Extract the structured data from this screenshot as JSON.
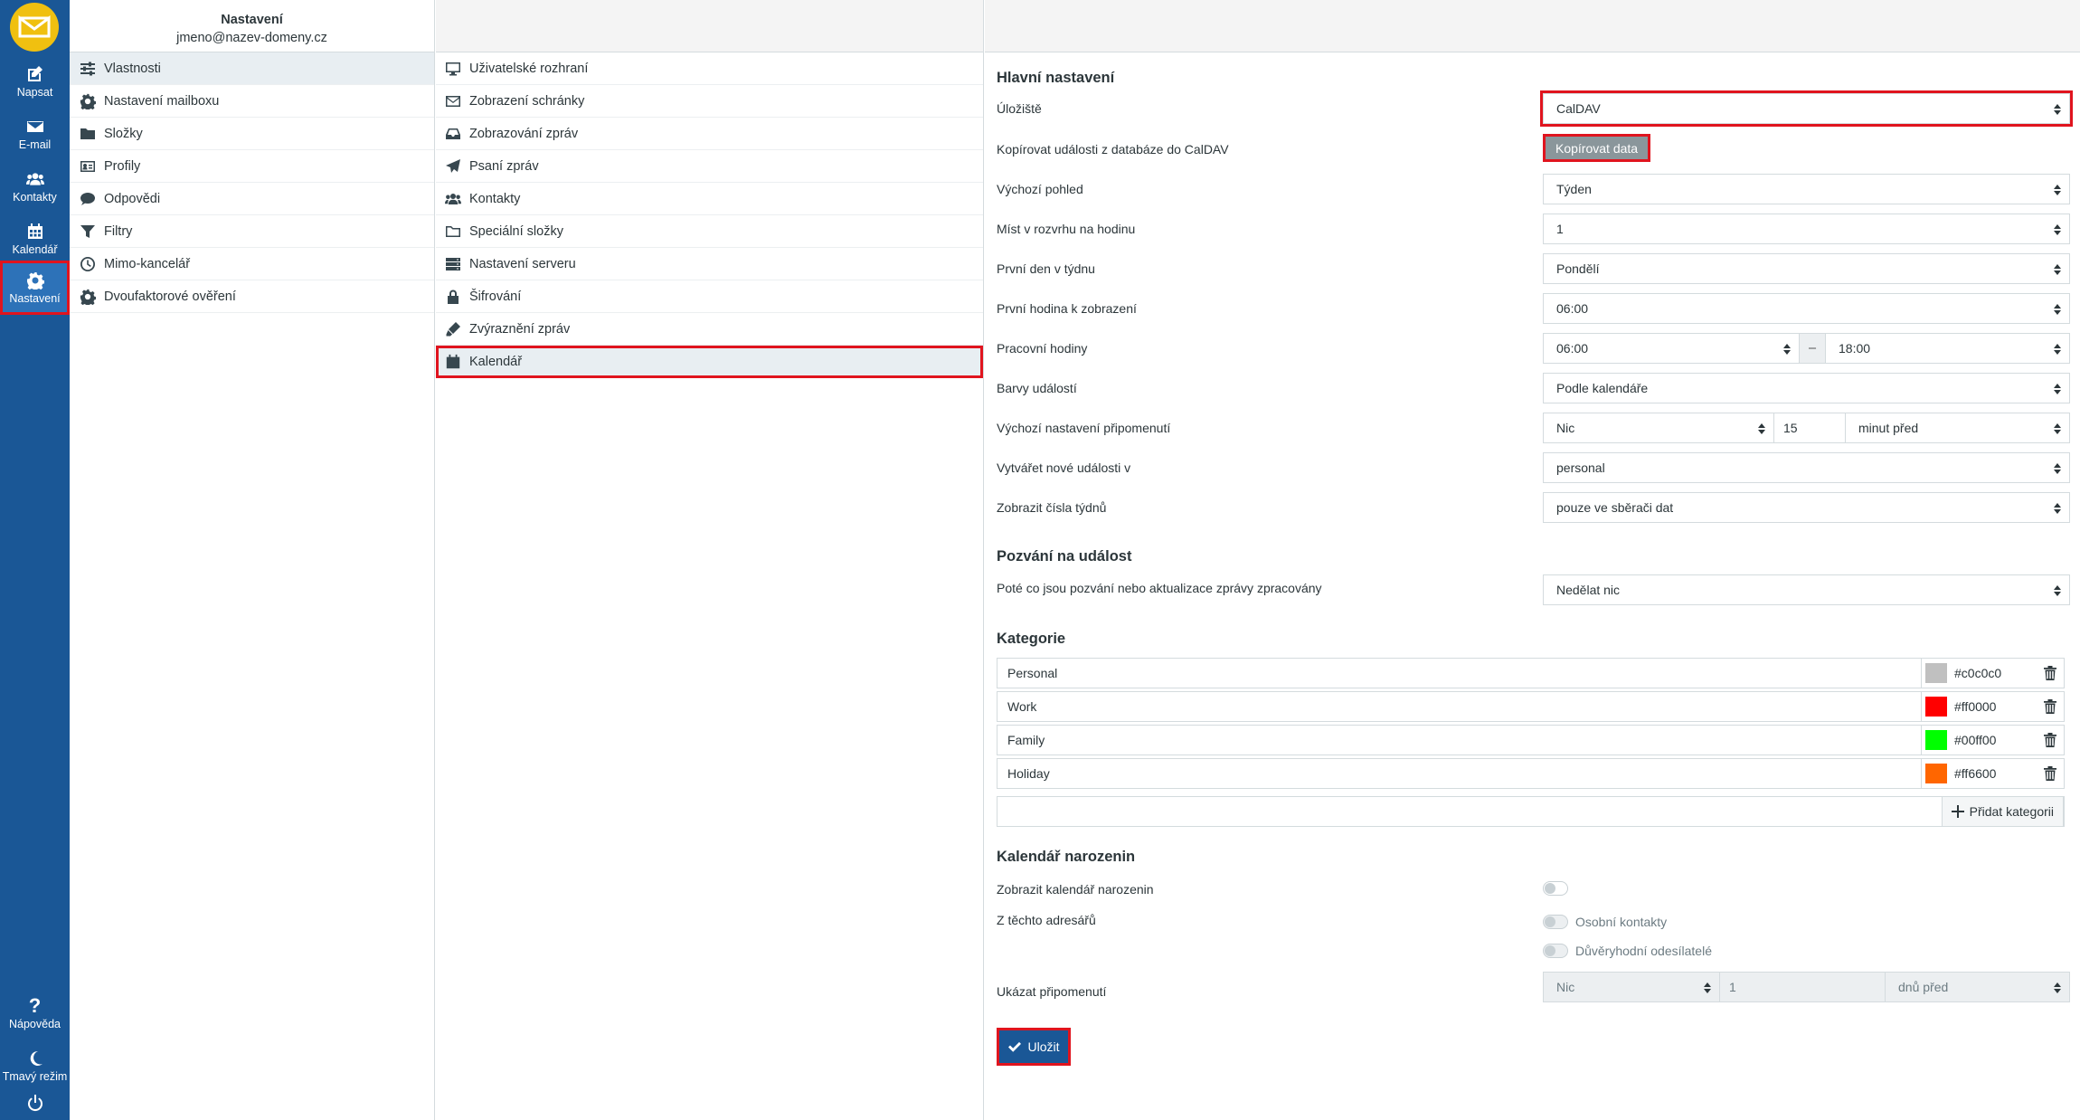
{
  "rail": {
    "items": [
      {
        "label": "Napsat",
        "icon": "compose-icon"
      },
      {
        "label": "E-mail",
        "icon": "envelope-icon"
      },
      {
        "label": "Kontakty",
        "icon": "users-icon"
      },
      {
        "label": "Kalendář",
        "icon": "calendar-icon"
      },
      {
        "label": "Nastavení",
        "icon": "gear-icon"
      }
    ],
    "bottom": [
      {
        "label": "Nápověda",
        "icon": "help-icon"
      },
      {
        "label": "Tmavý režim",
        "icon": "moon-icon"
      }
    ]
  },
  "col1": {
    "title": "Nastavení",
    "subtitle": "jmeno@nazev-domeny.cz",
    "items": [
      {
        "label": "Vlastnosti"
      },
      {
        "label": "Nastavení mailboxu"
      },
      {
        "label": "Složky"
      },
      {
        "label": "Profily"
      },
      {
        "label": "Odpovědi"
      },
      {
        "label": "Filtry"
      },
      {
        "label": "Mimo-kancelář"
      },
      {
        "label": "Dvoufaktorové ověření"
      }
    ]
  },
  "col2": {
    "items": [
      {
        "label": "Uživatelské rozhraní"
      },
      {
        "label": "Zobrazení schránky"
      },
      {
        "label": "Zobrazování zpráv"
      },
      {
        "label": "Psaní zpráv"
      },
      {
        "label": "Kontakty"
      },
      {
        "label": "Speciální složky"
      },
      {
        "label": "Nastavení serveru"
      },
      {
        "label": "Šifrování"
      },
      {
        "label": "Zvýraznění zpráv"
      },
      {
        "label": "Kalendář"
      }
    ]
  },
  "main": {
    "section_main": "Hlavní nastavení",
    "storage_label": "Úložiště",
    "storage_value": "CalDAV",
    "copy_label": "Kopírovat události z databáze do CalDAV",
    "copy_button": "Kopírovat data",
    "view_label": "Výchozí pohled",
    "view_value": "Týden",
    "slots_label": "Míst v rozvrhu na hodinu",
    "slots_value": "1",
    "firstday_label": "První den v týdnu",
    "firstday_value": "Pondělí",
    "firsthour_label": "První hodina k zobrazení",
    "firsthour_value": "06:00",
    "workhours_label": "Pracovní hodiny",
    "workhours_from": "06:00",
    "workhours_sep": "–",
    "workhours_to": "18:00",
    "colors_label": "Barvy událostí",
    "colors_value": "Podle kalendáře",
    "alarm_label": "Výchozí nastavení připomenutí",
    "alarm_type": "Nic",
    "alarm_offset": "15",
    "alarm_unit": "minut před",
    "newevents_label": "Vytvářet nové události v",
    "newevents_value": "personal",
    "weeknum_label": "Zobrazit čísla týdnů",
    "weeknum_value": "pouze ve sběrači dat",
    "section_invite": "Pozvání na událost",
    "invite_label": "Poté co jsou pozvání nebo aktualizace zprávy zpracovány",
    "invite_value": "Nedělat nic",
    "section_categories": "Kategorie",
    "categories": [
      {
        "name": "Personal",
        "color": "#c0c0c0",
        "hex": "#c0c0c0"
      },
      {
        "name": "Work",
        "color": "#ff0000",
        "hex": "#ff0000"
      },
      {
        "name": "Family",
        "color": "#00ff00",
        "hex": "#00ff00"
      },
      {
        "name": "Holiday",
        "color": "#ff6600",
        "hex": "#ff6600"
      }
    ],
    "add_category": "Přidat kategorii",
    "section_birthdays": "Kalendář narozenin",
    "birthdays_show_label": "Zobrazit kalendář narozenin",
    "birthdays_from_label": "Z těchto adresářů",
    "addressbook_1": "Osobní kontakty",
    "addressbook_2": "Důvěryhodní odesílatelé",
    "birthday_alarm_label": "Ukázat připomenutí",
    "birthday_alarm_type": "Nic",
    "birthday_alarm_offset": "1",
    "birthday_alarm_unit": "dnů před",
    "save_button": "Uložit"
  },
  "colors": {
    "rail": "#1a5796",
    "accent_red": "#e0141e",
    "logo": "#f0c010"
  }
}
